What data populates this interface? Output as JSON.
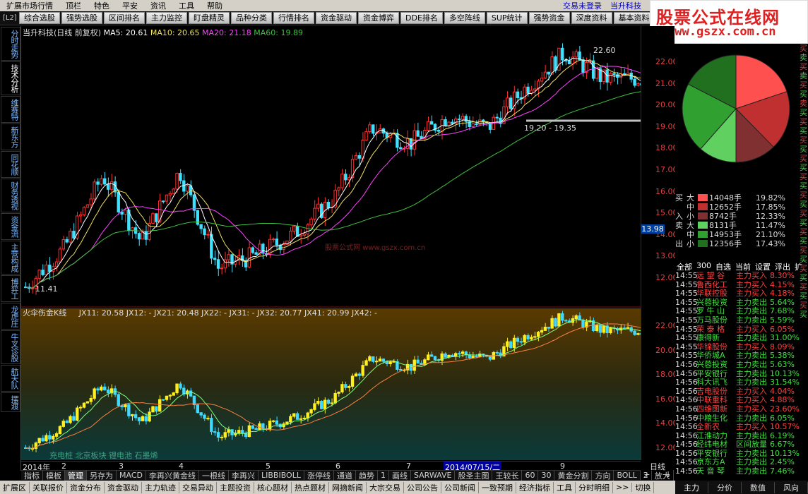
{
  "menubar": {
    "items": [
      "扩展市场行情",
      "顶栏",
      "特色",
      "平安",
      "资讯",
      "工具",
      "帮助"
    ],
    "login": "交易未登录",
    "stock": "当升科技"
  },
  "toolbar": {
    "level": "[L2]",
    "buttons": [
      "综合选股",
      "强势选股",
      "区间排名",
      "主力监控",
      "盯盘精灵",
      "品种分类",
      "行情排名",
      "资金驱动",
      "资金博弈",
      "DDE排名",
      "多空阵线",
      "SUP统计",
      "强势资金",
      "深度资料",
      "基本资料"
    ]
  },
  "logo": {
    "line1": "股票公式在线网",
    "line2": "www.gszx.com.cn"
  },
  "left_tabs": [
    "分时走势",
    "技术分析",
    "维赛特",
    "新东方",
    "同花顺",
    "财务透视",
    "资金流",
    "主营构成",
    "博弈工",
    "龙虎庄",
    "牛叉诊股",
    "航天队",
    "摆渡"
  ],
  "chart_header": {
    "name": "当升科技(日线 前复权)",
    "ma5_label": "MA5:",
    "ma5": "20.61",
    "ma10_label": "MA10:",
    "ma10": "20.65",
    "ma20_label": "MA20:",
    "ma20": "21.18",
    "ma60_label": "MA60:",
    "ma60": "19.89"
  },
  "sub_header": {
    "name": "火伞伤金K线",
    "items": [
      "JX11: 20.58",
      "JX12: -",
      "JX21: 20.48",
      "JX22: -",
      "JX31: -",
      "JX32: 20.77",
      "JX41: 20.99",
      "JX42: -"
    ]
  },
  "annotations": {
    "high": "22.60",
    "support": "19.20 - 19.35",
    "low": "11.41",
    "watermark": "股票公式网 www.gszx.com.cn",
    "bottom_note": "充电桩 北京板块 锂电池 石墨烯"
  },
  "price_axis_main": [
    "22.00",
    "21.00",
    "20.00",
    "19.00",
    "18.00",
    "17.00",
    "16.00",
    "15.00",
    "14.00",
    "13.00",
    "12.00"
  ],
  "price_axis_sub": [
    "22.00",
    "20.00",
    "18.00",
    "16.00",
    "14.00",
    "12.00"
  ],
  "current_price": "13.98",
  "dates": [
    "2014年",
    "2",
    "3",
    "4",
    "5",
    "6",
    "7",
    "2014/07/15/二",
    "9"
  ],
  "period": "日线",
  "colors": {
    "bull": "#ff3030",
    "bear": "#40e0ff",
    "ma5": "#ffffff",
    "ma10": "#f0e060",
    "ma20": "#ff40ff",
    "ma60": "#40c040",
    "sub_bull": "#ffee20",
    "sub_bear": "#40d8ff"
  },
  "fund_flow": [
    {
      "side": "买",
      "level": "大",
      "volume": "14048手",
      "pct": "19.82%",
      "color": "#ff5050"
    },
    {
      "side": "",
      "level": "中",
      "volume": "12652手",
      "pct": "17.85%",
      "color": "#c03030"
    },
    {
      "side": "入",
      "level": "小",
      "volume": "8742手",
      "pct": "12.33%",
      "color": "#803030"
    },
    {
      "side": "卖",
      "level": "大",
      "volume": "8131手",
      "pct": "11.47%",
      "color": "#60d060"
    },
    {
      "side": "",
      "level": "中",
      "volume": "14953手",
      "pct": "21.10%",
      "color": "#30a030"
    },
    {
      "side": "出",
      "level": "小",
      "volume": "12356手",
      "pct": "17.43%",
      "color": "#207020"
    }
  ],
  "list_header": [
    "全部",
    "300",
    "自选",
    "当前",
    "设置",
    "浮出",
    "扩"
  ],
  "ticks": [
    {
      "time": "14:55",
      "name": "远 望 谷",
      "action": "主力买入",
      "pct": "8.30%",
      "up": true
    },
    {
      "time": "14:55",
      "name": "鲁西化工",
      "action": "主力买入",
      "pct": "4.15%",
      "up": true
    },
    {
      "time": "14:55",
      "name": "华联控股",
      "action": "主力买入",
      "pct": "4.18%",
      "up": true
    },
    {
      "time": "14:55",
      "name": "兴蓉投资",
      "action": "主力卖出",
      "pct": "5.64%",
      "up": false
    },
    {
      "time": "14:55",
      "name": "罗 牛 山",
      "action": "主力卖出",
      "pct": "7.68%",
      "up": false
    },
    {
      "time": "14:55",
      "name": "万马股份",
      "action": "主力卖出",
      "pct": "5.59%",
      "up": false
    },
    {
      "time": "14:55",
      "name": "荣 泰 格",
      "action": "主力买入",
      "pct": "6.05%",
      "up": true
    },
    {
      "time": "14:55",
      "name": "康得新",
      "action": "主力卖出",
      "pct": "31.00%",
      "up": false
    },
    {
      "time": "14:55",
      "name": "华锦股份",
      "action": "主力买入",
      "pct": "8.09%",
      "up": true
    },
    {
      "time": "14:55",
      "name": "华侨城A",
      "action": "主力卖出",
      "pct": "5.38%",
      "up": false
    },
    {
      "time": "14:56",
      "name": "兴蓉投资",
      "action": "主力卖出",
      "pct": "5.63%",
      "up": false
    },
    {
      "time": "14:56",
      "name": "平安银行",
      "action": "主力卖出",
      "pct": "10.13%",
      "up": false
    },
    {
      "time": "14:56",
      "name": "科大讯飞",
      "action": "主力卖出",
      "pct": "31.54%",
      "up": false
    },
    {
      "time": "14:56",
      "name": "吉电股份",
      "action": "主力买入",
      "pct": "4.04%",
      "up": true
    },
    {
      "time": "14:56",
      "name": "中联重科",
      "action": "主力买入",
      "pct": "4.88%",
      "up": true
    },
    {
      "time": "14:56",
      "name": "四维图新",
      "action": "主力买入",
      "pct": "23.60%",
      "up": true
    },
    {
      "time": "14:56",
      "name": "中粮生化",
      "action": "主力卖出",
      "pct": "6.05%",
      "up": false
    },
    {
      "time": "14:56",
      "name": "全新农",
      "action": "主力买入",
      "pct": "10.57%",
      "up": true
    },
    {
      "time": "14:56",
      "name": "江淮动力",
      "action": "主力卖出",
      "pct": "6.19%",
      "up": false
    },
    {
      "time": "14:56",
      "name": "经纬电材",
      "action": "区间放量",
      "pct": "6.67%",
      "up": false
    },
    {
      "time": "14:56",
      "name": "平安银行",
      "action": "主力卖出",
      "pct": "10.13%",
      "up": false
    },
    {
      "time": "14:56",
      "name": "京东方A",
      "action": "主力卖出",
      "pct": "2.45%",
      "up": false
    },
    {
      "time": "14:56",
      "name": "天 音 琴",
      "action": "主力卖出",
      "pct": "7.46%",
      "up": false
    }
  ],
  "right_tabs": [
    "买",
    "卖",
    "买",
    "卖",
    "买",
    "买",
    "卖",
    "买",
    "买",
    "买",
    "买",
    "买",
    "买",
    "买",
    "买",
    "买",
    "买",
    "买",
    "买",
    "买",
    "买",
    "买",
    "买",
    "买",
    "买",
    "买",
    "买",
    "买",
    "买",
    "买"
  ],
  "indicator_bar": [
    "指标",
    "模板",
    "管理",
    "另存为",
    "MACD",
    "李再兴黄金线",
    "一根线",
    "李再兴",
    "LIBBIBOLL",
    "涨停线",
    "通道",
    "趋势",
    "1",
    "画线",
    "SARWAVE",
    "股圣主图",
    "王较长",
    "60",
    "30",
    "黄金分割",
    "方向",
    "BOLL",
    "2",
    "放大",
    ">>"
  ],
  "bottom_bar": [
    "扩展区",
    "关联报价",
    "资金分布",
    "资金驱动",
    "主力轨迹",
    "交易异动",
    "主题投资",
    "核心题材",
    "热点题材",
    "网摘新闻",
    "大宗交易",
    "公司公告",
    "公司新闻",
    "一致预期",
    "经济指标",
    "工具",
    "分时明细",
    ">>",
    "切换"
  ],
  "right_bottom": [
    "主力",
    "分价",
    "数值",
    "风向"
  ],
  "zoom": [
    "+",
    "-",
    "↓"
  ]
}
